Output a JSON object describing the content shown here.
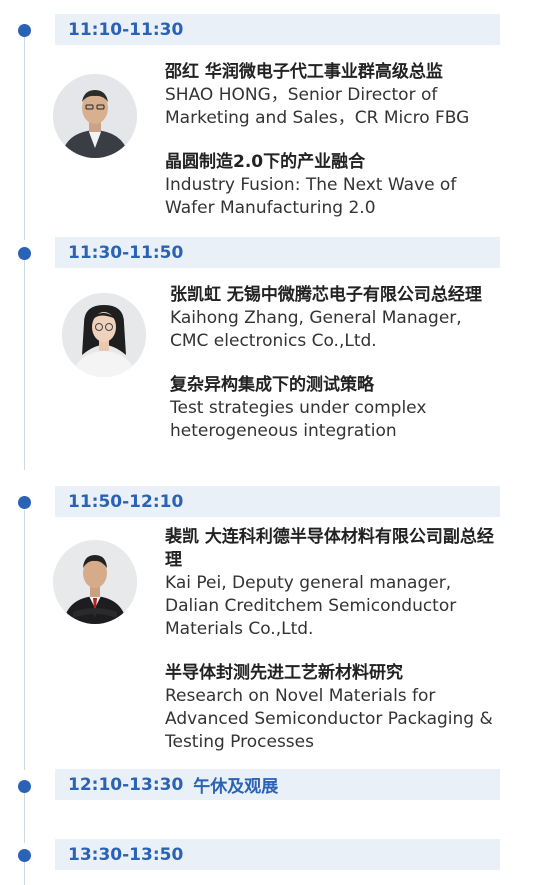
{
  "sessions": [
    {
      "time": "11:10-11:30",
      "speaker_cn": "邵红 华润微电子代工事业群高级总监",
      "speaker_en": "SHAO HONG，Senior Director of Marketing and Sales，CR Micro FBG",
      "topic_cn": "晶圆制造2.0下的产业融合",
      "topic_en": "Industry Fusion: The Next Wave of Wafer Manufacturing 2.0"
    },
    {
      "time": "11:30-11:50",
      "speaker_cn": "张凯虹 无锡中微腾芯电子有限公司总经理",
      "speaker_en": "Kaihong Zhang, General Manager, CMC electronics Co.,Ltd.",
      "topic_cn": "复杂异构集成下的测试策略",
      "topic_en": "Test strategies under complex heterogeneous integration"
    },
    {
      "time": "11:50-12:10",
      "speaker_cn": "裴凯 大连科利德半导体材料有限公司副总经理",
      "speaker_en": "Kai Pei, Deputy general manager, Dalian Creditchem Semiconductor Materials Co.,Ltd.",
      "topic_cn": "半导体封测先进工艺新材料研究",
      "topic_en": "Research on Novel Materials for Advanced Semiconductor Packaging & Testing Processes"
    }
  ],
  "break": {
    "time": "12:10-13:30",
    "label": "午休及观展"
  },
  "next": {
    "time": "13:30-13:50"
  },
  "colors": {
    "accent": "#2a62b6",
    "bar": "#eaf0f7",
    "line": "#cfd8e3"
  },
  "icons": {
    "avatar": "person-photo-icon",
    "timeline_dot": "dot-icon"
  }
}
